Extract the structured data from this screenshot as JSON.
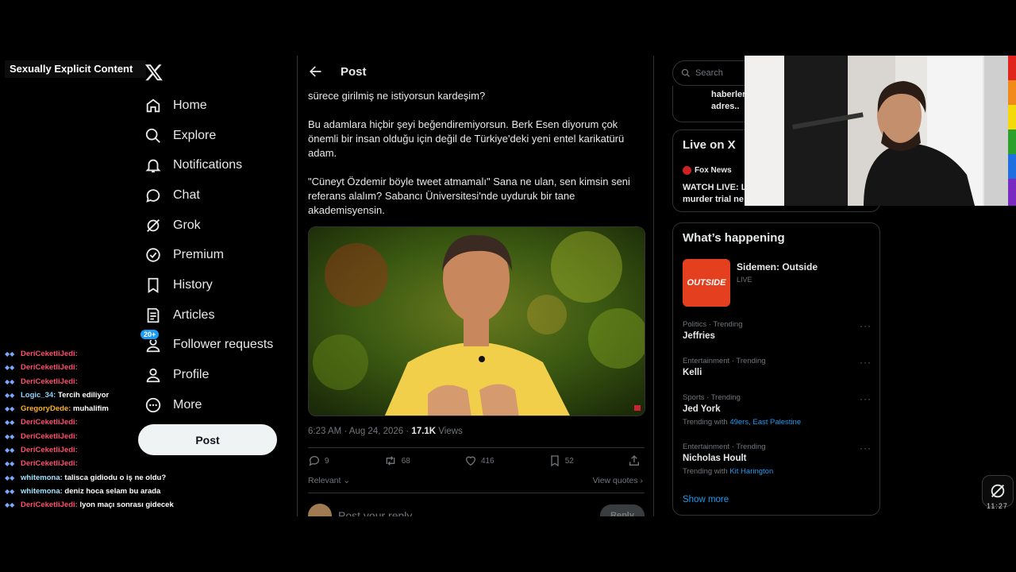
{
  "overlay_warning": "Sexually Explicit Content",
  "nav": {
    "items": [
      {
        "label": "Home",
        "icon": "home-icon"
      },
      {
        "label": "Explore",
        "icon": "search-icon"
      },
      {
        "label": "Notifications",
        "icon": "bell-icon"
      },
      {
        "label": "Chat",
        "icon": "chat-icon"
      },
      {
        "label": "Grok",
        "icon": "grok-icon"
      },
      {
        "label": "Premium",
        "icon": "verified-icon"
      },
      {
        "label": "History",
        "icon": "bookmark-icon"
      },
      {
        "label": "Articles",
        "icon": "article-icon"
      },
      {
        "label": "Follower requests",
        "icon": "follower-requests-icon",
        "badge": "20+"
      },
      {
        "label": "Profile",
        "icon": "profile-icon"
      },
      {
        "label": "More",
        "icon": "more-icon"
      }
    ],
    "post_button": "Post"
  },
  "chat": [
    {
      "user": "DeriCeketliJedi:",
      "msg": "",
      "color": "#ff4d6d"
    },
    {
      "user": "DeriCeketliJedi:",
      "msg": "",
      "color": "#ff4d6d"
    },
    {
      "user": "DeriCeketliJedi:",
      "msg": "",
      "color": "#ff4d6d"
    },
    {
      "user": "Logic_34:",
      "msg": "Tercih ediliyor",
      "color": "#8fd3ff"
    },
    {
      "user": "GregoryDede:",
      "msg": "muhalifim",
      "color": "#ffb020"
    },
    {
      "user": "DeriCeketliJedi:",
      "msg": "",
      "color": "#ff4d6d"
    },
    {
      "user": "DeriCeketliJedi:",
      "msg": "",
      "color": "#ff4d6d"
    },
    {
      "user": "DeriCeketliJedi:",
      "msg": "",
      "color": "#ff4d6d"
    },
    {
      "user": "DeriCeketliJedi:",
      "msg": "",
      "color": "#ff4d6d"
    },
    {
      "user": "whitemona:",
      "msg": "talisca gidiodu o iş ne oldu?",
      "color": "#9fe3ff"
    },
    {
      "user": "whitemona:",
      "msg": "deniz hoca selam bu arada",
      "color": "#9fe3ff"
    },
    {
      "user": "DeriCeketliJedi:",
      "msg": "lyon maçı sonrası gidecek",
      "color": "#ff4d6d"
    }
  ],
  "main": {
    "title": "Post",
    "text_top": "sürece girilmiş ne istiyorsun kardeşim?",
    "paragraph_1": "Bu adamlara hiçbir şeyi beğendiremiyorsun. Berk Esen diyorum çok önemli bir insan olduğu için değil de Türkiye'deki yeni entel karikatürü adam.",
    "paragraph_2": "\"Cüneyt Özdemir böyle tweet atmamalı\" Sana ne ulan, sen kimsin seni referans alalım? Sabancı Üniversitesi'nde uyduruk bir tane akademisyensin.",
    "timestamp": "6:23 AM · Aug 24, 2026 · ",
    "views_count": "17.1K",
    "views_label": " Views",
    "actions": {
      "replies": "9",
      "reposts": "68",
      "likes": "416",
      "bookmarks": "52"
    },
    "relevant": "Relevant",
    "view_quotes": "View quotes",
    "reply_placeholder": "Post your reply",
    "reply_button": "Reply"
  },
  "right": {
    "search_placeholder": "Search",
    "top_card_text": "haberler\nadres..",
    "live_title": "Live on X",
    "live_source": "Fox News",
    "live_headline": "WATCH LIVE: L\nmurder trial ne",
    "happening_title": "What’s happening",
    "featured": {
      "name": "Sidemen: Outside",
      "status": "LIVE",
      "thumb_text": "OUTSIDE"
    },
    "trends": [
      {
        "context": "Politics · Trending",
        "name": "Jeffries",
        "with_label": "",
        "with": ""
      },
      {
        "context": "Entertainment · Trending",
        "name": "Kelli",
        "with_label": "",
        "with": ""
      },
      {
        "context": "Sports · Trending",
        "name": "Jed York",
        "with_label": "Trending with ",
        "with": "49ers, East Palestine"
      },
      {
        "context": "Entertainment · Trending",
        "name": "Nicholas Hoult",
        "with_label": "Trending with ",
        "with": "Kit Harington"
      }
    ],
    "show_more": "Show more"
  },
  "clock": "11:27",
  "colors": {
    "accent": "#1d9bf0",
    "background": "#000000",
    "border": "#2f3336",
    "muted": "#71767b"
  }
}
